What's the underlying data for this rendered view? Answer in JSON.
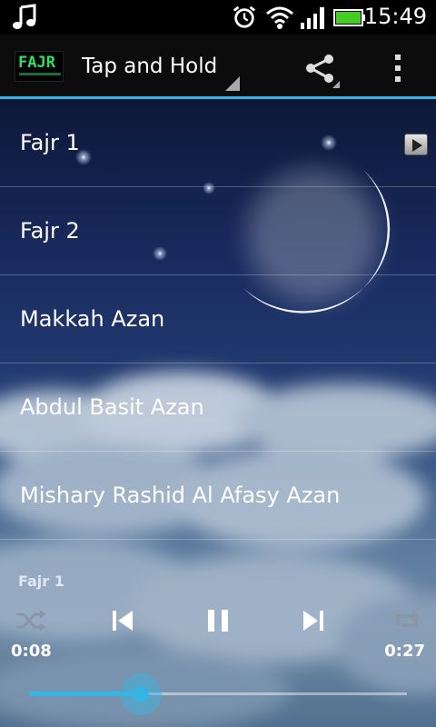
{
  "status_bar": {
    "time": "15:49",
    "icons": [
      "music-note-icon",
      "alarm-icon",
      "wifi-icon",
      "signal-icon",
      "battery-icon"
    ],
    "battery_color": "#44cc22"
  },
  "action_bar": {
    "logo_text": "FAJR",
    "title": "Tap and Hold",
    "accent_color": "#33b5e5"
  },
  "list": {
    "items": [
      {
        "label": "Fajr 1",
        "has_play_icon": true
      },
      {
        "label": "Fajr 2"
      },
      {
        "label": "Makkah Azan"
      },
      {
        "label": "Abdul Basit Azan"
      },
      {
        "label": "Mishary Rashid Al Afasy Azan"
      }
    ]
  },
  "player": {
    "now_playing": "Fajr 1",
    "current_time": "0:08",
    "duration": "0:27",
    "progress": 0.296,
    "state": "playing"
  }
}
